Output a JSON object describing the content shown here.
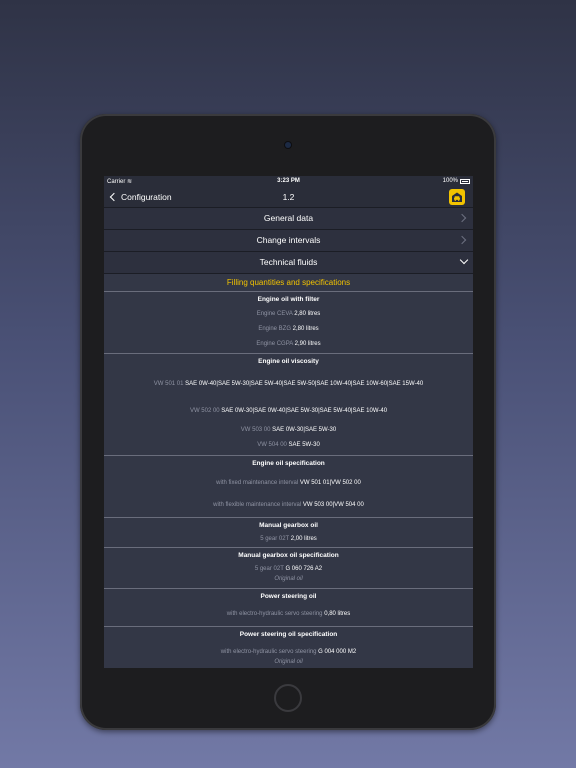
{
  "status_bar": {
    "carrier": "Carrier",
    "time": "3:23 PM",
    "battery": "100%"
  },
  "nav": {
    "back_label": "Configuration",
    "title": "1.2"
  },
  "menu": [
    {
      "label": "General data"
    },
    {
      "label": "Change intervals"
    },
    {
      "label": "Technical fluids"
    }
  ],
  "section_title": "Filling quantities and specifications",
  "blocks": [
    {
      "title": "Engine oil with filter",
      "lines": [
        {
          "key": "Engine CEVA",
          "value": "2,80 litres"
        },
        {
          "key": "Engine BZG",
          "value": "2,80 litres"
        },
        {
          "key": "Engine CGPA",
          "value": "2,90 litres"
        }
      ]
    },
    {
      "title": "Engine oil viscosity",
      "lines": [
        {
          "key": "VW 501 01",
          "value": "SAE 0W-40|SAE 5W-30|SAE 5W-40|SAE 5W-50|SAE 10W-40|SAE 10W-60|SAE 15W-40"
        },
        {
          "key": "VW 502 00",
          "value": "SAE 0W-30|SAE 0W-40|SAE 5W-30|SAE 5W-40|SAE 10W-40"
        },
        {
          "key": "VW 503 00",
          "value": "SAE 0W-30|SAE 5W-30"
        },
        {
          "key": "VW 504 00",
          "value": "SAE 5W-30"
        }
      ]
    },
    {
      "title": "Engine oil specification",
      "lines": [
        {
          "key": "with fixed maintenance interval",
          "value": "VW 501 01|VW 502 00"
        },
        {
          "key": "with flexible maintenance interval",
          "value": "VW 503 00|VW 504 00"
        }
      ]
    },
    {
      "title": "Manual gearbox oil",
      "lines": [
        {
          "key": "5 gear 02T",
          "value": "2,00 litres"
        }
      ]
    },
    {
      "title": "Manual gearbox oil specification",
      "lines": [
        {
          "key": "5 gear 02T",
          "value": "G 060 726 A2"
        }
      ],
      "note": "Original oil"
    },
    {
      "title": "Power steering oil",
      "lines": [
        {
          "key": "with electro-hydraulic servo steering",
          "value": "0,80 litres"
        }
      ]
    },
    {
      "title": "Power steering oil specification",
      "lines": [
        {
          "key": "with electro-hydraulic servo steering",
          "value": "G 004 000 M2"
        }
      ],
      "note": "Original oil"
    }
  ]
}
